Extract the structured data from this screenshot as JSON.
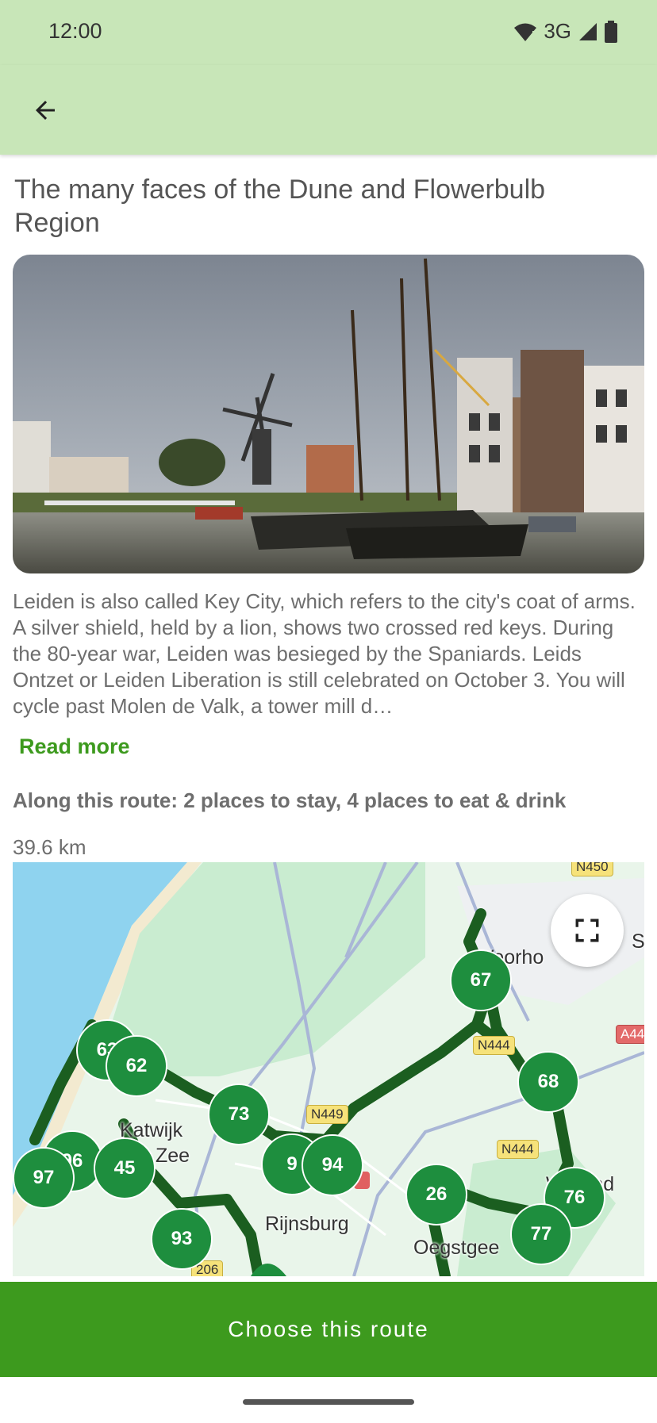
{
  "status": {
    "time": "12:00",
    "network": "3G",
    "icons": [
      "wifi-icon",
      "signal-icon",
      "battery-icon"
    ]
  },
  "appbar": {
    "back_icon": "arrow-left-icon"
  },
  "route": {
    "title": "The many faces of the Dune and Flowerbulb Region",
    "description": "Leiden is also called Key City, which refers to the city's coat of arms. A silver shield, held by a lion, shows two crossed red keys. During the 80-year war, Leiden was besieged by the Spaniards. Leids Ontzet or Leiden Liberation is still celebrated on October 3. You will cycle past Molen de Valk, a tower mill d…",
    "read_more": "Read more",
    "along_route": "Along this route: 2 places to stay, 4 places to eat & drink",
    "distance": "39.6 km"
  },
  "map": {
    "towns": {
      "katwijk_1": "Katwijk",
      "katwijk_2": "Zee",
      "rijnsburg": "Rijnsburg",
      "voorhout": "Voorho",
      "oegstgeest": "Oegstgee",
      "warmond": "W   ond",
      "s": "S"
    },
    "roads": {
      "n450": "N450",
      "n444a": "N444",
      "n444b": "N444",
      "n449": "N449",
      "n206": "206",
      "a44": "A44"
    },
    "markers": {
      "m67": "67",
      "m63": "63",
      "m62": "62",
      "m68": "68",
      "m73": "73",
      "m96": "96",
      "m97": "97",
      "m45": "45",
      "m9": "9",
      "m94": "94",
      "m26": "26",
      "m76": "76",
      "m93": "93",
      "m77": "77"
    },
    "fullscreen_icon": "fullscreen-icon"
  },
  "cta": {
    "label": "Choose this route"
  },
  "colors": {
    "header": "#c8e6b8",
    "accent": "#3d9a1e",
    "marker": "#1e8e3e",
    "route_line": "#1b5e20"
  }
}
